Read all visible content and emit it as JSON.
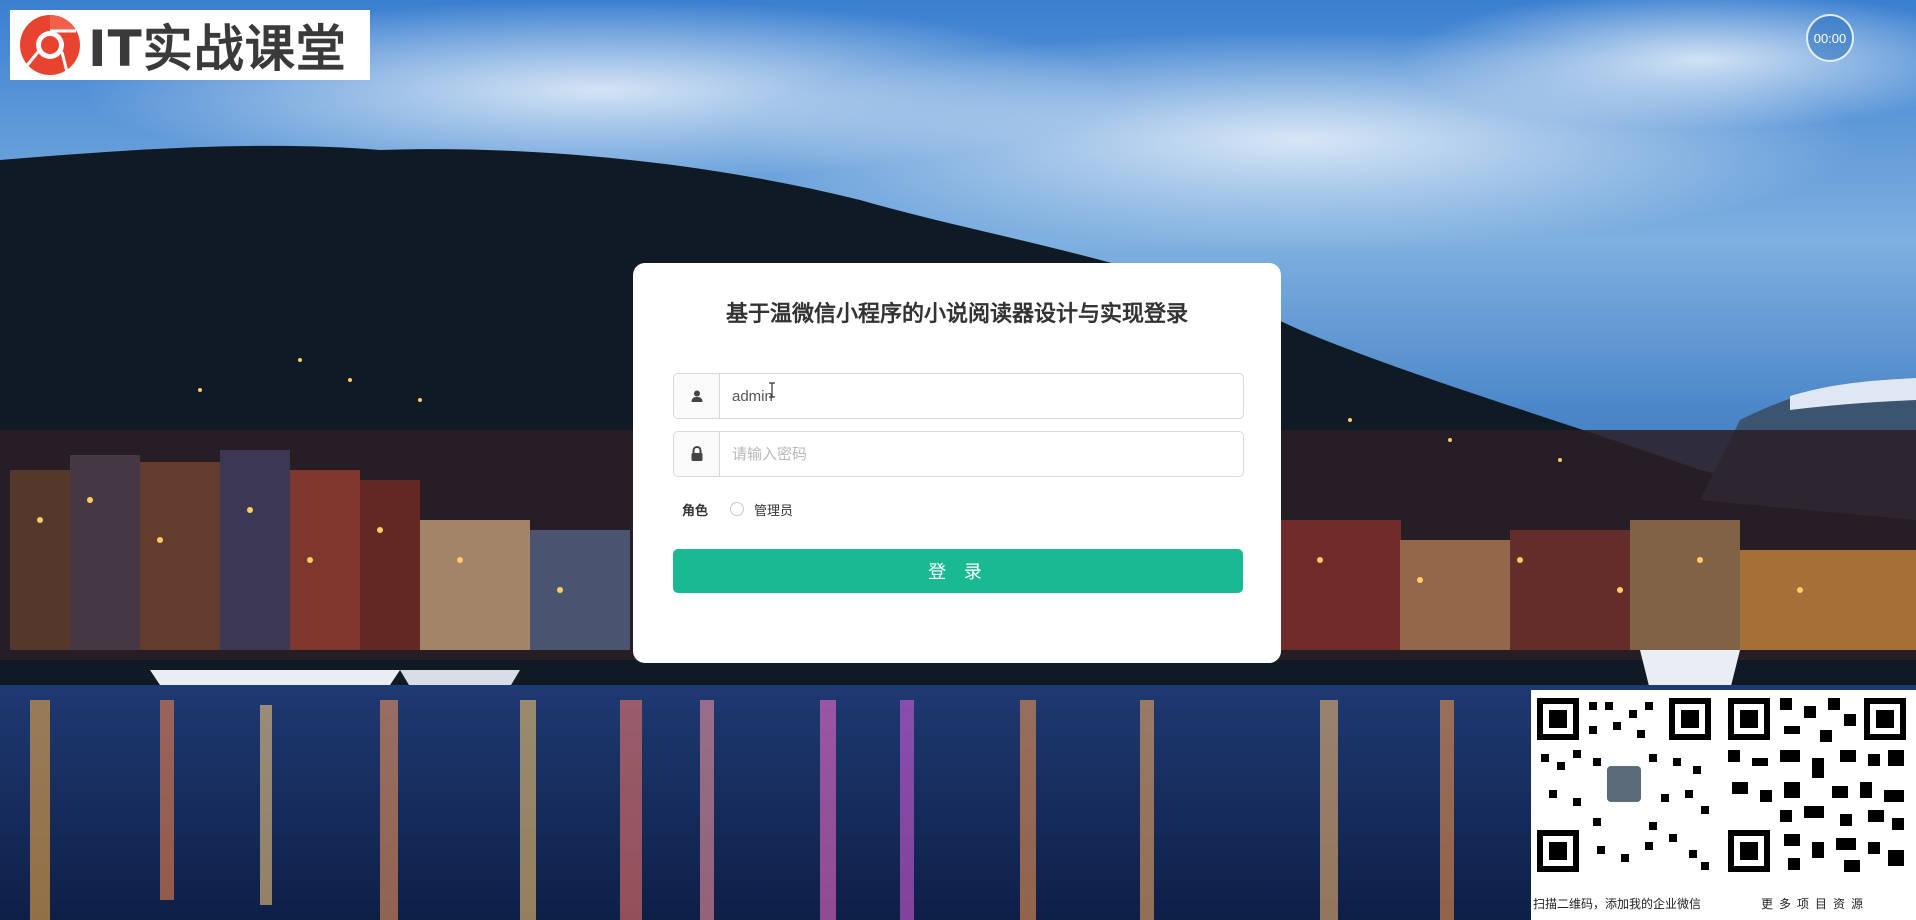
{
  "brand": {
    "name": "IT实战课堂"
  },
  "timer": {
    "text": "00:00"
  },
  "login": {
    "title": "基于温微信小程序的小说阅读器设计与实现登录",
    "username_value": "admin",
    "password_placeholder": "请输入密码",
    "role_label": "角色",
    "role_option": "管理员",
    "submit_label": "登 录"
  },
  "promo": {
    "caption": "扫描二维码，添加我的企业微信",
    "more": "更多项目资源"
  },
  "colors": {
    "primary": "#19b992",
    "card": "#ffffff",
    "brand_red": "#e8432f"
  },
  "icons": [
    "user-icon",
    "lock-icon",
    "chrome-logo-icon",
    "text-cursor-icon"
  ]
}
